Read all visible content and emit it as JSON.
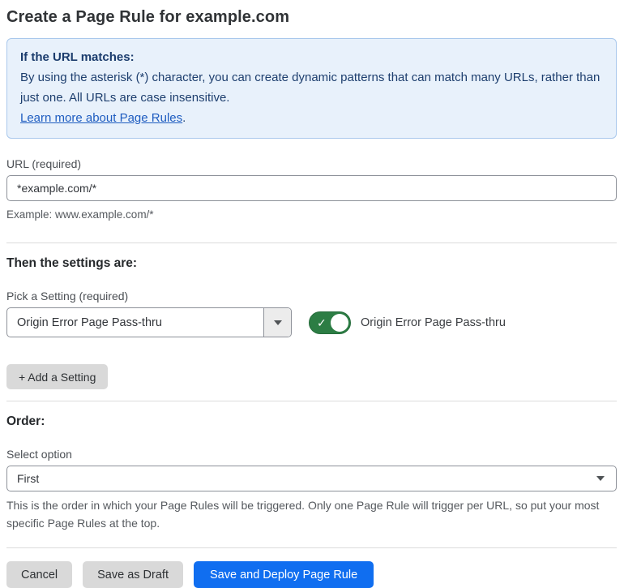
{
  "page": {
    "title": "Create a Page Rule for example.com"
  },
  "info_box": {
    "heading": "If the URL matches:",
    "body": "By using the asterisk (*) character, you can create dynamic patterns that can match many URLs, rather than just one. All URLs are case insensitive.",
    "link_label": "Learn more about Page Rules",
    "link_suffix": "."
  },
  "url_field": {
    "label": "URL (required)",
    "value": "*example.com/*",
    "helper": "Example: www.example.com/*"
  },
  "settings_section": {
    "heading": "Then the settings are:",
    "picker_label": "Pick a Setting (required)",
    "picker_value": "Origin Error Page Pass-thru",
    "toggle_state": "on",
    "toggle_check": "✓",
    "toggle_label": "Origin Error Page Pass-thru",
    "add_button_label": "+ Add a Setting"
  },
  "order_section": {
    "heading": "Order:",
    "select_label": "Select option",
    "select_value": "First",
    "helper": "This is the order in which your Page Rules will be triggered. Only one Page Rule will trigger per URL, so put your most specific Page Rules at the top."
  },
  "footer": {
    "cancel_label": "Cancel",
    "save_draft_label": "Save as Draft",
    "save_deploy_label": "Save and Deploy Page Rule"
  },
  "colors": {
    "info_bg": "#e8f1fb",
    "info_border": "#a9c8ec",
    "info_text": "#1d3e6e",
    "link_blue": "#1e5cc0",
    "toggle_green": "#2c7d44",
    "primary_blue": "#106ef0",
    "button_gray": "#d9d9d9"
  }
}
